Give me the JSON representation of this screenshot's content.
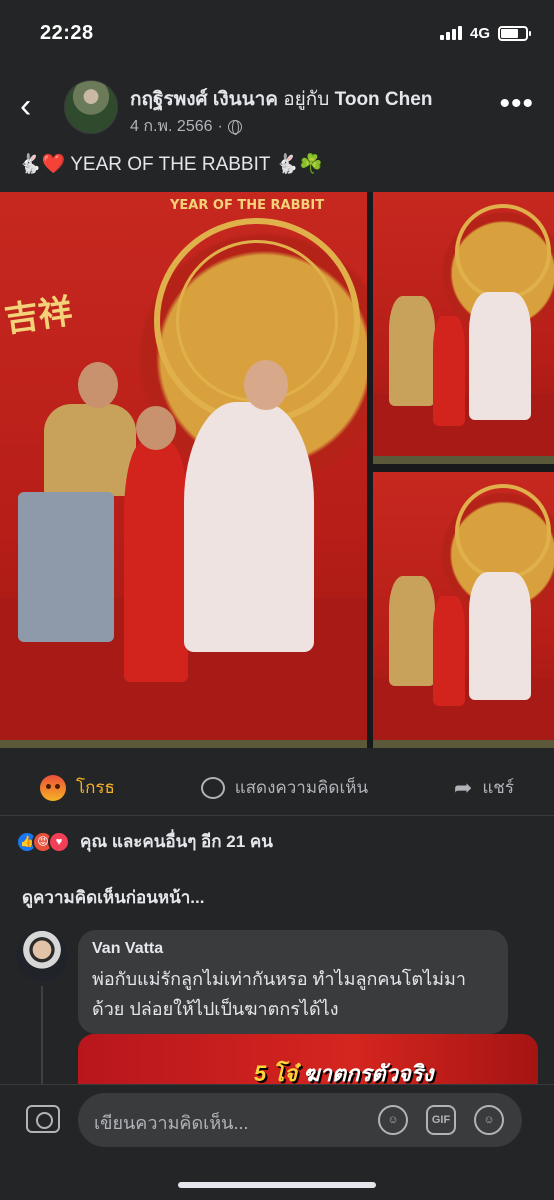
{
  "status": {
    "time": "22:28",
    "network": "4G"
  },
  "post": {
    "author_name": "กฤฐิรพงศ์ เงินนาค",
    "with_text": "อยู่กับ",
    "tagged_name": "Toon Chen",
    "date": "4 ก.พ. 2566",
    "dot": "·",
    "caption": "🐇❤️ YEAR OF THE RABBIT 🐇☘️"
  },
  "photo": {
    "banner_text": "YEAR OF THE RABBIT",
    "side_text": "吉祥"
  },
  "actions": {
    "angry_label": "โกรธ",
    "comment_label": "แสดงความคิดเห็น",
    "share_label": "แชร์"
  },
  "reactions": {
    "summary": "คุณ และคนอื่นๆ อีก 21 คน"
  },
  "comments": {
    "view_previous": "ดูความคิดเห็นก่อนหน้า...",
    "items": [
      {
        "name": "Van Vatta",
        "text": "พ่อกับแม่รักลูกไม่เท่ากันหรอ ทำไมลูกคนโตไม่มาด้วย ปล่อยให้ไปเป็นฆาตกรได้ไง",
        "image_text_prefix": "5 โจ๋",
        "image_text": "ฆาตกรตัวจริง"
      }
    ]
  },
  "composer": {
    "placeholder": "เขียนความคิดเห็น...",
    "gif_label": "GIF"
  },
  "colors": {
    "background": "#242526",
    "angry_accent": "#f7b125",
    "like_blue": "#1877f2"
  }
}
